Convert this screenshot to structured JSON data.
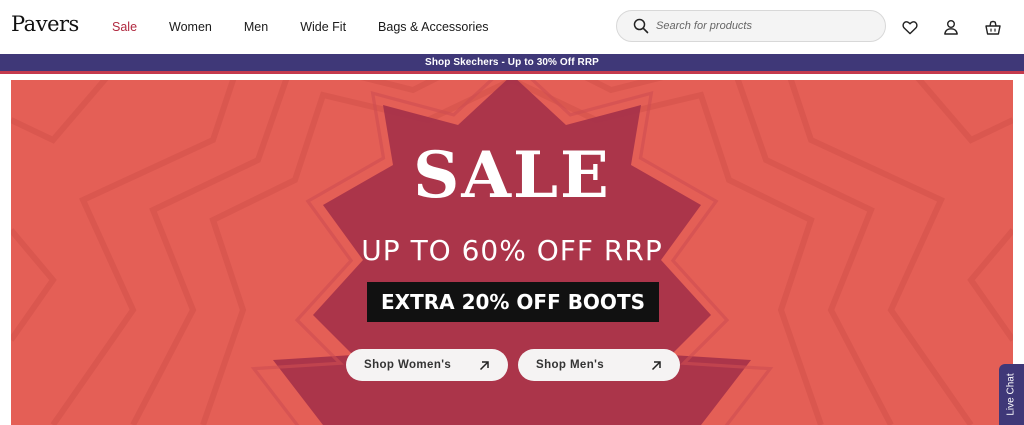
{
  "brand": {
    "logo_text": "Pavers"
  },
  "nav": {
    "items": [
      {
        "label": "Sale"
      },
      {
        "label": "Women"
      },
      {
        "label": "Men"
      },
      {
        "label": "Wide Fit"
      },
      {
        "label": "Bags & Accessories"
      }
    ]
  },
  "search": {
    "placeholder": "Search for products",
    "icon": "search-icon"
  },
  "header_icons": [
    "heart-icon",
    "account-icon",
    "basket-icon"
  ],
  "promo_bar": {
    "text": "Shop Skechers - Up to 30% Off RRP"
  },
  "hero": {
    "title": "SALE",
    "subtitle": "UP TO 60% OFF RRP",
    "badge": "EXTRA 20% OFF BOOTS",
    "buttons": [
      {
        "label": "Shop Women's",
        "icon": "arrow-up-right-icon"
      },
      {
        "label": "Shop Men's",
        "icon": "arrow-up-right-icon"
      }
    ]
  },
  "live_chat": {
    "label": "Live Chat"
  },
  "colors": {
    "accent_red": "#b0283f",
    "promo_purple": "#3f3878",
    "hero_bg": "#e45f56",
    "hero_shape": "#a8334a"
  }
}
